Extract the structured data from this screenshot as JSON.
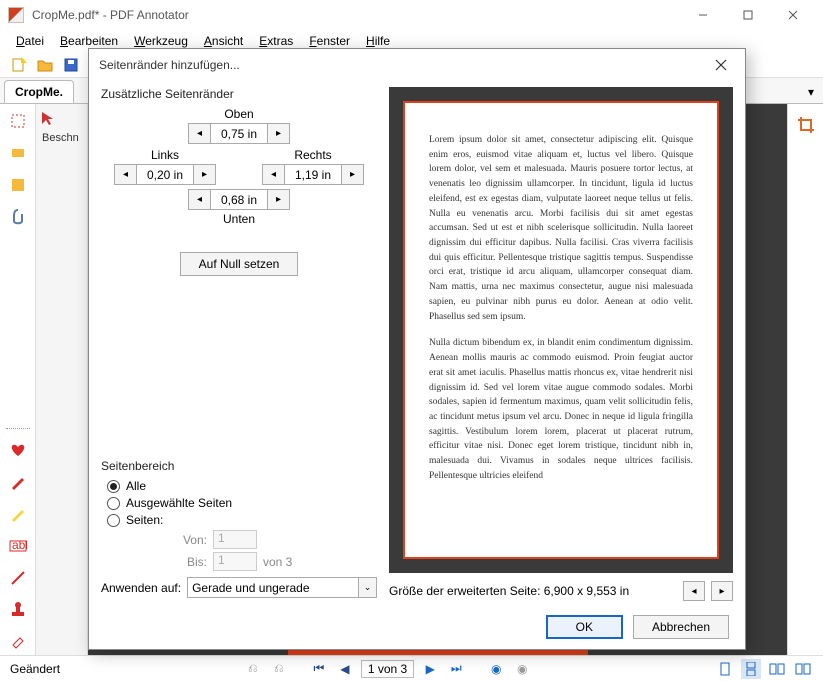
{
  "window": {
    "title": "CropMe.pdf* - PDF Annotator"
  },
  "menu": {
    "file": "Datei",
    "edit": "Bearbeiten",
    "tool": "Werkzeug",
    "view": "Ansicht",
    "extras": "Extras",
    "window": "Fenster",
    "help": "Hilfe"
  },
  "tab": {
    "name": "CropMe."
  },
  "left_panel": {
    "header": "Beschn"
  },
  "dialog": {
    "title": "Seitenränder hinzufügen...",
    "margins_group": "Zusätzliche Seitenränder",
    "top_label": "Oben",
    "left_label": "Links",
    "right_label": "Rechts",
    "bottom_label": "Unten",
    "top_value": "0,75 in",
    "left_value": "0,20 in",
    "right_value": "1,19 in",
    "bottom_value": "0,68 in",
    "zero_button": "Auf Null setzen",
    "range_group": "Seitenbereich",
    "radio_all": "Alle",
    "radio_selected": "Ausgewählte Seiten",
    "radio_pages": "Seiten:",
    "from_label": "Von:",
    "to_label": "Bis:",
    "from_value": "1",
    "to_value": "1",
    "of_total": "von 3",
    "apply_label": "Anwenden auf:",
    "apply_value": "Gerade und ungerade",
    "size_label": "Größe der erweiterten Seite: 6,900 x 9,553 in",
    "ok": "OK",
    "cancel": "Abbrechen"
  },
  "preview": {
    "para1": "Lorem ipsum dolor sit amet, consectetur adipiscing elit. Quisque enim eros, euismod vitae aliquam et, luctus vel libero. Quisque lorem dolor, vel sem et malesuada. Mauris posuere tortor lectus, at venenatis leo dignissim ullamcorper. In tincidunt, ligula id luctus eleifend, est ex egestas diam, vulputate laoreet neque tellus ut felis. Nulla eu venenatis arcu. Morbi facilisis dui sit amet egestas accumsan. Sed ut est et nibh scelerisque sollicitudin. Nulla laoreet dignissim dui efficitur dapibus. Nulla facilisi. Cras viverra facilisis dui quis efficitur. Pellentesque tristique sagittis tempus. Suspendisse orci erat, tristique id arcu aliquam, ullamcorper consequat diam. Nam mattis, urna nec maximus consectetur, augue nisi malesuada sapien, eu pulvinar nibh purus eu dolor. Aenean at odio velit. Phasellus sed sem ipsum.",
    "para2": "Nulla dictum bibendum ex, in blandit enim condimentum dignissim. Aenean mollis mauris ac commodo euismod. Proin feugiat auctor erat sit amet iaculis. Phasellus mattis rhoncus ex, vitae hendrerit nisi dignissim id. Sed vel lorem vitae augue commodo sodales. Morbi sodales, sapien id fermentum maximus, quam velit sollicitudin felis, ac tincidunt metus ipsum vel arcu. Donec in neque id ligula fringilla sagittis. Vestibulum lorem lorem, placerat ut placerat rutrum, efficitur vitae nisi. Donec eget lorem tristique, tincidunt nibh in, malesuada dui. Vivamus in sodales neque ultrices facilisis. Pellentesque ultricies eleifend"
  },
  "status": {
    "left": "Geändert",
    "page": "1 von 3"
  }
}
